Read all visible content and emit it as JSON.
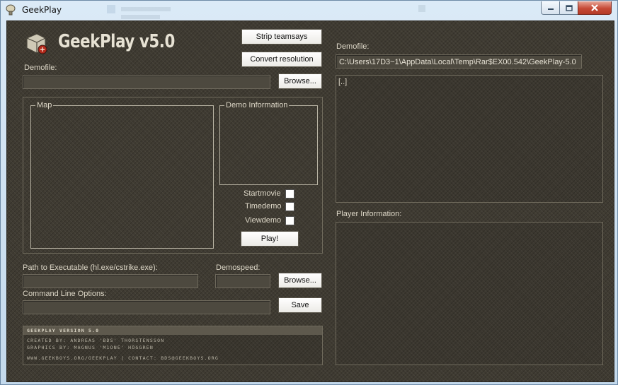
{
  "window": {
    "title": "GeekPlay",
    "controls": {
      "minimize_icon": "minimize-icon",
      "maximize_icon": "maximize-icon",
      "close_icon": "close-icon"
    }
  },
  "header": {
    "brand_title": "GeekPlay v5.0",
    "logo_icon": "geekplay-cube-logo-icon"
  },
  "toolbar": {
    "strip_label": "Strip teamsays",
    "convert_label": "Convert resolution"
  },
  "demo": {
    "label": "Demofile:",
    "value": "",
    "browse_label": "Browse..."
  },
  "preview": {
    "map_label": "Map",
    "info_label": "Demo Information",
    "options": [
      {
        "label": "Startmovie",
        "checked": false
      },
      {
        "label": "Timedemo",
        "checked": false
      },
      {
        "label": "Viewdemo",
        "checked": false
      }
    ],
    "play_label": "Play!"
  },
  "exec": {
    "path_label": "Path to Executable (hl.exe/cstrike.exe):",
    "path_value": "",
    "speed_label": "Demospeed:",
    "speed_value": "",
    "browse_label": "Browse...",
    "cmd_label": "Command Line Options:",
    "cmd_value": "",
    "save_label": "Save"
  },
  "credits": {
    "version_line": "GEEKPLAY VERSION 5.0",
    "created_line": "CREATED BY: ANDREAS 'BDS' THORSTENSSON",
    "graphics_line": "GRAPHICS BY: MAGNUS 'M1ONE' HÖGGREN",
    "contact_line": "WWW.GEEKBOYS.ORG/GEEKPLAY  |  CONTACT: BDS@GEEKBOYS.ORG"
  },
  "right": {
    "demofile_label": "Demofile:",
    "demofile_path": "C:\\Users\\17D3~1\\AppData\\Local\\Temp\\Rar$EX00.542\\GeekPlay-5.0",
    "demo_text": "[..]",
    "player_label": "Player Information:",
    "player_text": ""
  },
  "colors": {
    "background": "#3f3b32",
    "button_face": "#ffffff",
    "text": "#ddd7c7"
  }
}
